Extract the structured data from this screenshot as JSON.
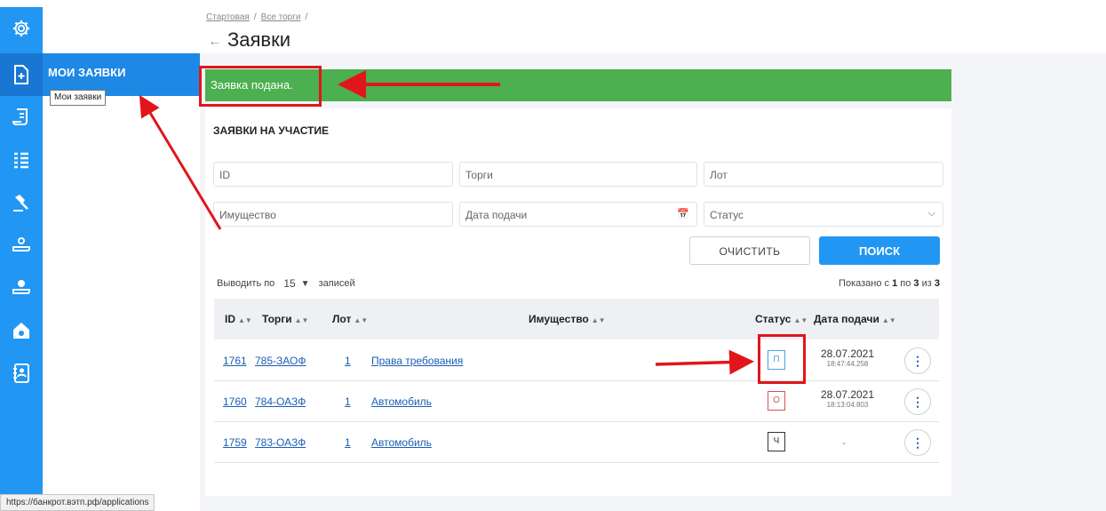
{
  "breadcrumb": {
    "home": "Стартовая",
    "sep1": "/",
    "trades": "Все торги",
    "sep2": "/"
  },
  "page_title": "Заявки",
  "sidebar": {
    "active_label": "МОИ ЗАЯВКИ",
    "tooltip": "Мои заявки"
  },
  "alert": "Заявка подана.",
  "section_title": "ЗАЯВКИ НА УЧАСТИЕ",
  "filters": {
    "id": "ID",
    "trades": "Торги",
    "lot": "Лот",
    "property": "Имущество",
    "date": "Дата подачи",
    "status": "Статус"
  },
  "buttons": {
    "clear": "ОЧИСТИТЬ",
    "search": "ПОИСК"
  },
  "pagination": {
    "prefix": "Выводить по",
    "per_page": "15",
    "suffix": "записей",
    "shown_a": "Показано с",
    "from": "1",
    "shown_b": "по",
    "to": "3",
    "shown_c": "из",
    "total": "3"
  },
  "table": {
    "headers": {
      "id": "ID",
      "trades": "Торги",
      "lot": "Лот",
      "property": "Имущество",
      "status": "Статус",
      "date": "Дата подачи"
    },
    "rows": [
      {
        "id": "1761",
        "trade": "785-ЗАОФ",
        "lot": "1",
        "property": "Права требования",
        "status": "П",
        "status_color": "#4aa3df",
        "date": "28.07.2021",
        "time": "18:47:44.258"
      },
      {
        "id": "1760",
        "trade": "784-ОАЗФ",
        "lot": "1",
        "property": "Автомобиль",
        "status": "О",
        "status_color": "#d9534f",
        "date": "28.07.2021",
        "time": "18:13:04.803"
      },
      {
        "id": "1759",
        "trade": "783-ОАЗФ",
        "lot": "1",
        "property": "Автомобиль",
        "status": "Ч",
        "status_color": "#333333",
        "date": "-",
        "time": ""
      }
    ]
  },
  "status_url": "https://банкрот.вэтп.рф/applications",
  "colors": {
    "primary": "#2196f3",
    "success": "#4caf50",
    "annotation": "#e0161b"
  }
}
